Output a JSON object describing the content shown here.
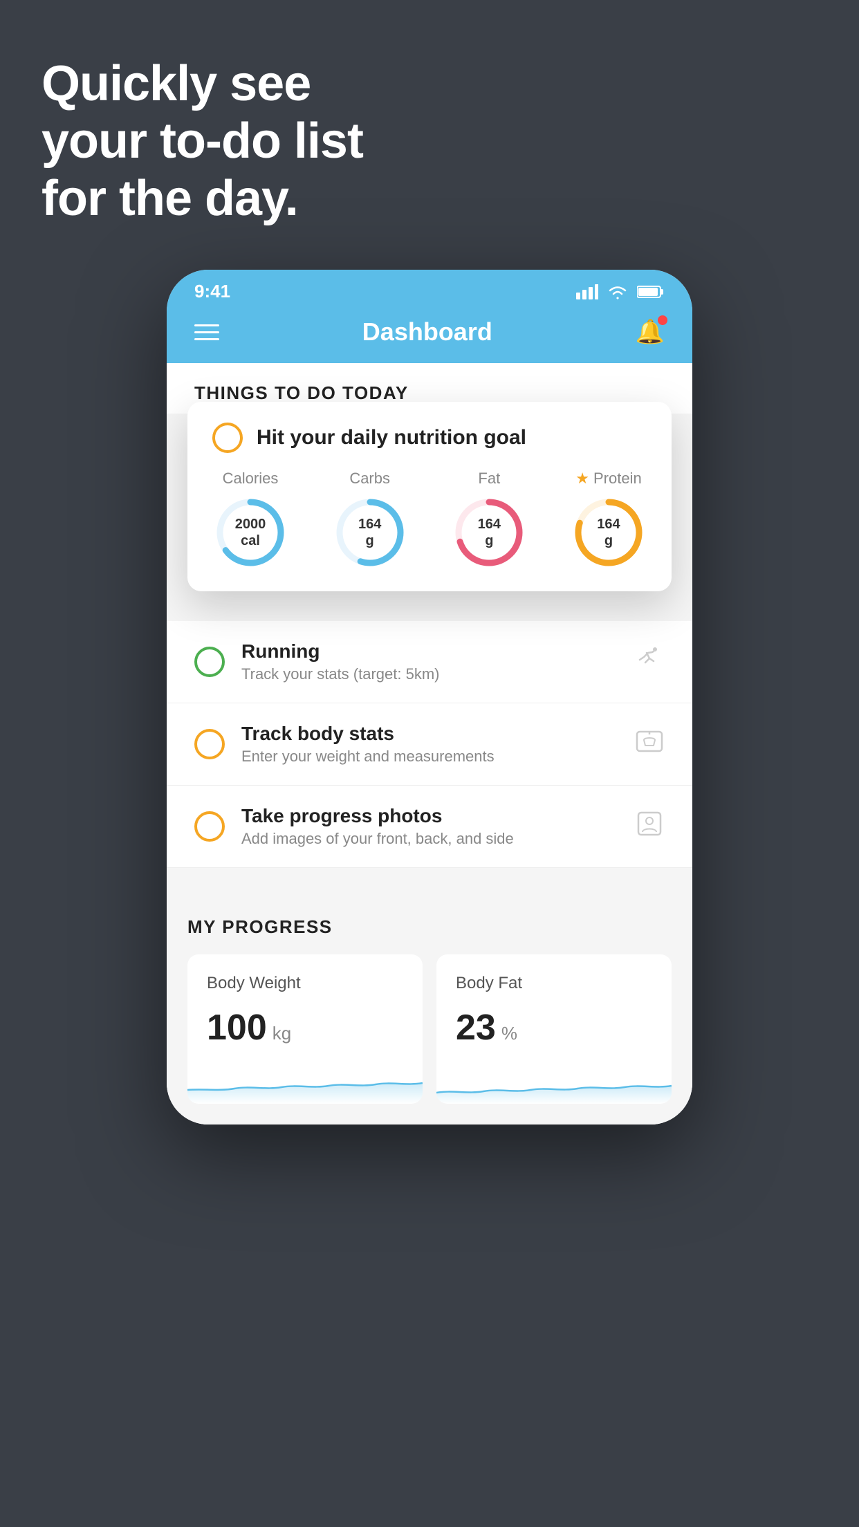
{
  "background_color": "#3a3f47",
  "hero": {
    "line1": "Quickly see",
    "line2": "your to-do list",
    "line3": "for the day."
  },
  "status_bar": {
    "time": "9:41",
    "signal": "▌▌▌",
    "wifi": "wifi",
    "battery": "battery"
  },
  "header": {
    "title": "Dashboard"
  },
  "section": {
    "things_today": "THINGS TO DO TODAY"
  },
  "floating_card": {
    "title": "Hit your daily nutrition goal",
    "stats": [
      {
        "label": "Calories",
        "value": "2000",
        "unit": "cal",
        "color": "#5bbde8",
        "percent": 65
      },
      {
        "label": "Carbs",
        "value": "164",
        "unit": "g",
        "color": "#5bbde8",
        "percent": 55
      },
      {
        "label": "Fat",
        "value": "164",
        "unit": "g",
        "color": "#e85b7a",
        "percent": 70
      },
      {
        "label": "Protein",
        "value": "164",
        "unit": "g",
        "color": "#f5a623",
        "percent": 80,
        "starred": true
      }
    ]
  },
  "todo_items": [
    {
      "title": "Running",
      "subtitle": "Track your stats (target: 5km)",
      "circle_color": "green",
      "icon": "👟"
    },
    {
      "title": "Track body stats",
      "subtitle": "Enter your weight and measurements",
      "circle_color": "yellow",
      "icon": "⚖️"
    },
    {
      "title": "Take progress photos",
      "subtitle": "Add images of your front, back, and side",
      "circle_color": "yellow",
      "icon": "👤"
    }
  ],
  "progress": {
    "section_title": "MY PROGRESS",
    "cards": [
      {
        "title": "Body Weight",
        "value": "100",
        "unit": "kg"
      },
      {
        "title": "Body Fat",
        "value": "23",
        "unit": "%"
      }
    ]
  }
}
